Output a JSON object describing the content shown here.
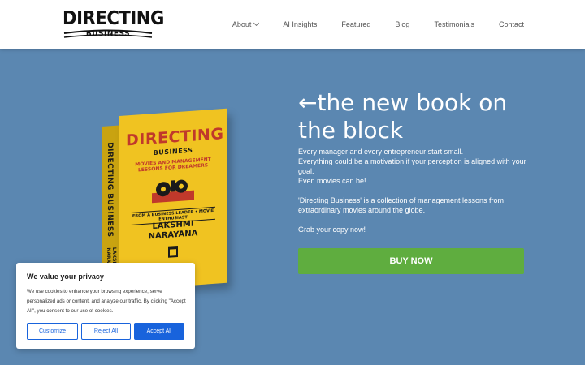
{
  "header": {
    "logo": {
      "top": "DIRECTING",
      "bottom": "BUSINESS"
    },
    "nav": [
      {
        "label": "About",
        "has_dropdown": true
      },
      {
        "label": "AI Insights"
      },
      {
        "label": "Featured"
      },
      {
        "label": "Blog"
      },
      {
        "label": "Testimonials"
      },
      {
        "label": "Contact"
      }
    ]
  },
  "book": {
    "spine_title": "DIRECTING BUSINESS",
    "spine_author": "LAKSHMI NARAYANA",
    "cover_title": "DIRECTING",
    "cover_subtitle": "BUSINESS",
    "cover_tagline": "MOVIES AND MANAGEMENT LESSONS FOR DREAMERS",
    "cover_leader": "FROM A BUSINESS LEADER • MOVIE ENTHUSIAST",
    "author_first": "LAKSHMI",
    "author_last": "NARAYANA"
  },
  "hero": {
    "title": "←the new book on the block",
    "line1": "Every manager and every entrepreneur start small.",
    "line2": "Everything could be a motivation if your perception is aligned with your goal.",
    "line3": "Even movies can be!",
    "para2": "'Directing Business' is a collection of management lessons from extraordinary movies around the globe.",
    "para3": "Grab your copy now!",
    "cta": "BUY NOW"
  },
  "cookie_banner": {
    "title": "We value your privacy",
    "text": "We use cookies to enhance your browsing experience, serve personalized ads or content, and analyze our traffic. By clicking \"Accept All\", you consent to our use of cookies.",
    "customize": "Customize",
    "reject": "Reject All",
    "accept": "Accept All"
  },
  "colors": {
    "background": "#5b87b1",
    "cta": "#5fad3f",
    "cookie_accent": "#1863dc",
    "book_cover": "#f0c321",
    "book_title": "#c0392b"
  }
}
